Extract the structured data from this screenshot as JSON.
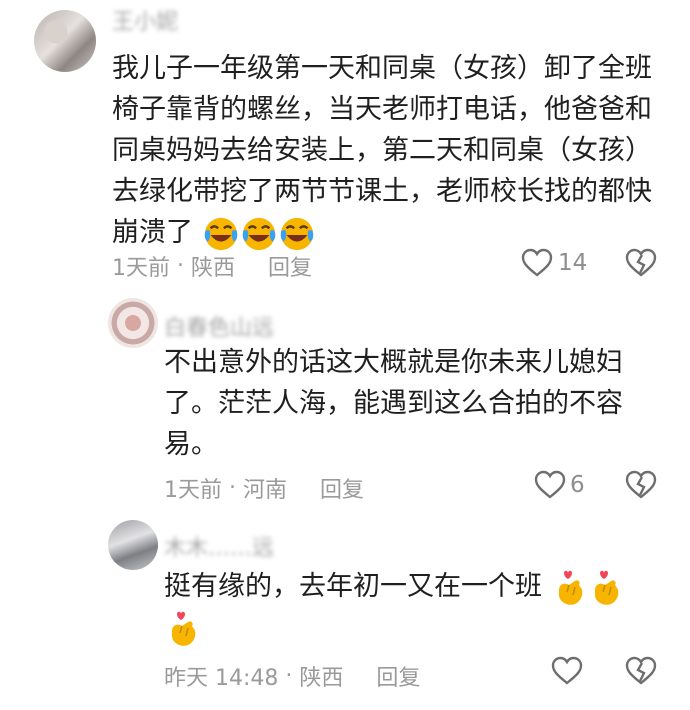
{
  "comments": [
    {
      "author": "王小妮",
      "lines": [
        "我儿子一年级第一天和同桌（女孩）卸了全班",
        "椅子靠背的螺丝，当天老师打电话，他爸爸和",
        "同桌妈妈去给安装上，第二天和同桌（女孩）",
        "去绿化带挖了两节节课土，老师校长找的都快",
        "崩溃了"
      ],
      "emoji": "crying-laughing-face",
      "time": "1天前",
      "separator": "·",
      "location": "陕西",
      "reply_label": "回复",
      "likes": "14"
    },
    {
      "author": "白春色山远",
      "lines": [
        "不出意外的话这大概就是你未来儿媳妇",
        "了。茫茫人海，能遇到这么合拍的不容",
        "易。"
      ],
      "time": "1天前",
      "separator": "·",
      "location": "河南",
      "reply_label": "回复",
      "likes": "6"
    },
    {
      "author": "木木……远",
      "lines": [
        "挺有缘的，去年初一又在一个班"
      ],
      "emoji": "finger-heart",
      "time": "昨天 14:48",
      "separator": "·",
      "location": "陕西",
      "reply_label": "回复",
      "likes": ""
    }
  ],
  "colors": {
    "text": "#1f1f1f",
    "meta": "#9a9a9a",
    "emoji_yellow": "#f7b500",
    "heart_red": "#f0465a"
  }
}
